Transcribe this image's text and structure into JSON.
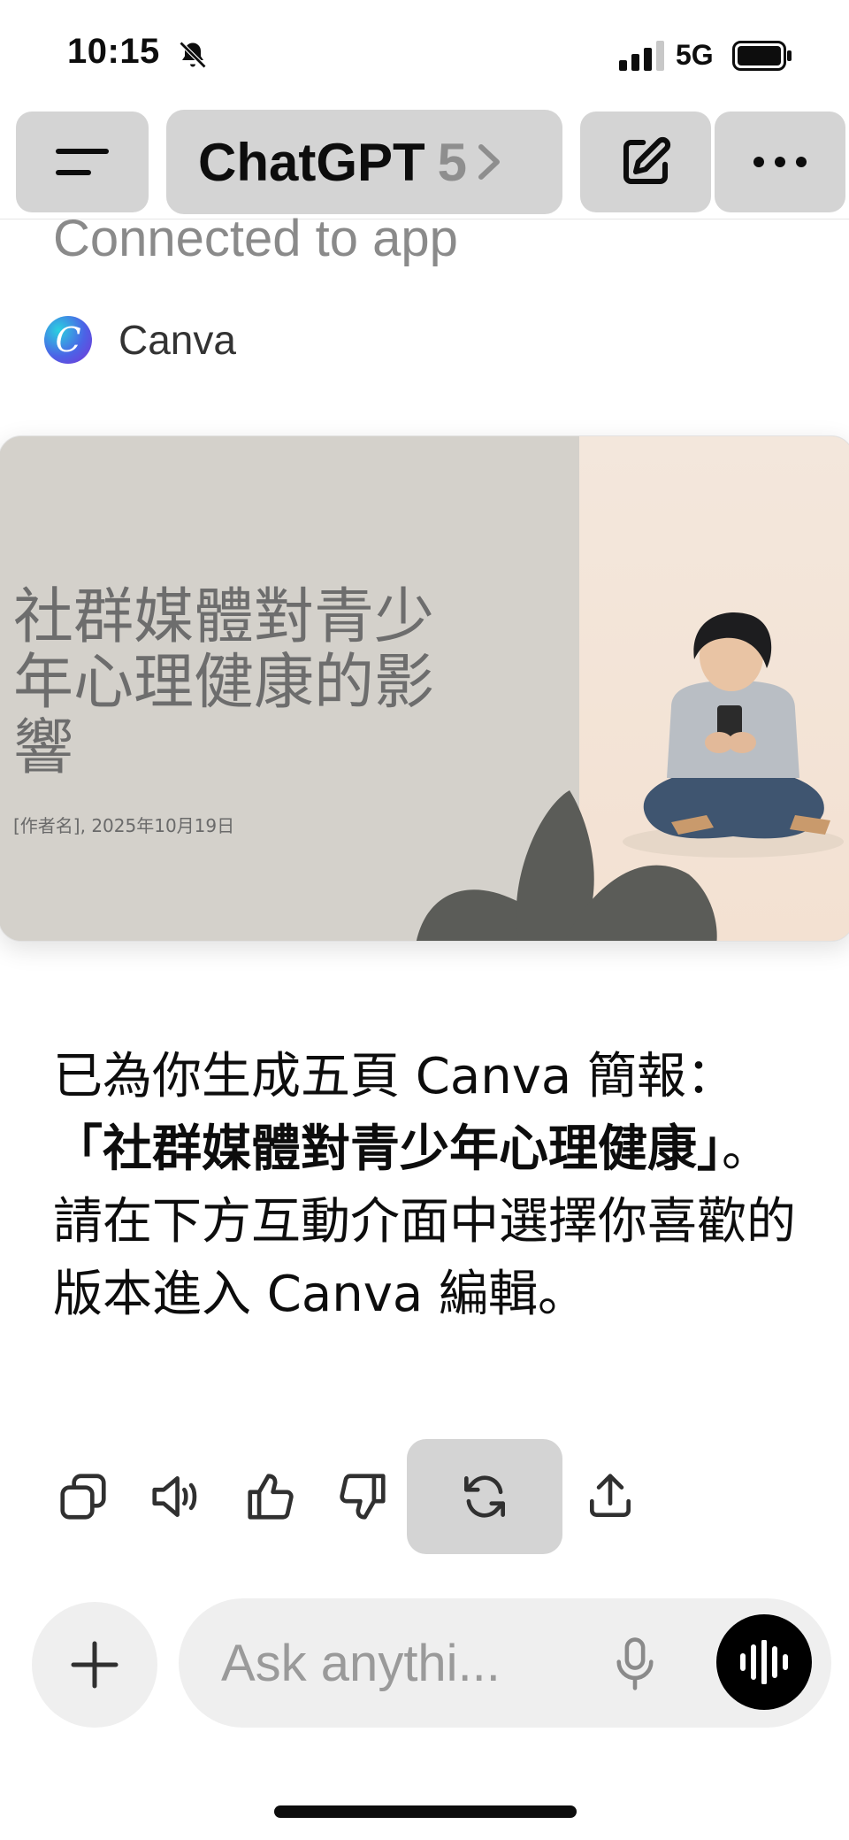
{
  "status_bar": {
    "time": "10:15",
    "network": "5G",
    "icons": [
      "bell-slash-icon",
      "signal-bars-icon",
      "battery-icon"
    ]
  },
  "nav": {
    "model_name": "ChatGPT",
    "model_version": "5",
    "icons": [
      "menu-icon",
      "chevron-right-icon",
      "compose-icon",
      "more-icon"
    ]
  },
  "connection": {
    "label": "Connected to app",
    "app_name": "Canva",
    "app_logo_letter": "C"
  },
  "slide": {
    "title": "社群媒體對青少年心理健康的影響",
    "subtitle": "[作者名], 2025年10月19日",
    "colors": {
      "left_bg": "#d4d1cb",
      "right_bg": "#f3e7dc",
      "leaf": "#5b5c58"
    }
  },
  "response": {
    "line1": "已為你生成五頁 Canva 簡報：",
    "bold": "「社群媒體對青少年心理健康」",
    "after_bold": "。",
    "line3": "請在下方互動介面中選擇你喜歡的版本進入 Canva 編輯。"
  },
  "actions": [
    "copy-icon",
    "read-aloud-icon",
    "thumbs-up-icon",
    "thumbs-down-icon",
    "regenerate-icon",
    "share-icon"
  ],
  "composer": {
    "placeholder": "Ask anythi...",
    "icons": [
      "plus-icon",
      "microphone-icon",
      "voice-waveform-icon"
    ]
  }
}
